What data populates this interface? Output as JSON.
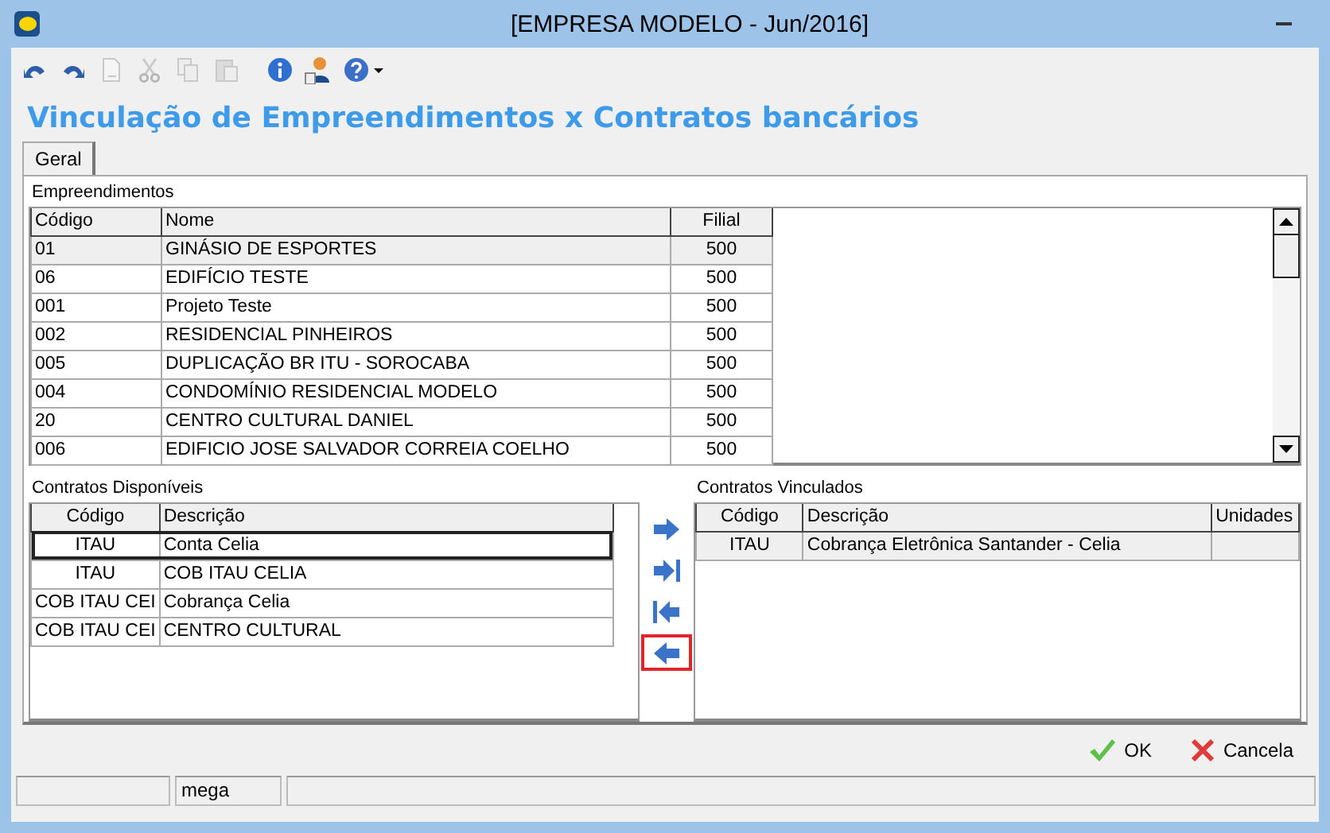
{
  "window": {
    "title": "[EMPRESA MODELO - Jun/2016]"
  },
  "toolbar": [
    {
      "kind": "undo",
      "disabled": false
    },
    {
      "kind": "redo",
      "disabled": false
    },
    {
      "kind": "document",
      "disabled": true
    },
    {
      "kind": "cut",
      "disabled": true
    },
    {
      "kind": "copy",
      "disabled": true
    },
    {
      "kind": "paste",
      "disabled": true
    },
    {
      "kind": "info",
      "disabled": false
    },
    {
      "kind": "user",
      "disabled": false
    },
    {
      "kind": "help",
      "disabled": false
    }
  ],
  "heading": "Vinculação de Empreendimentos x Contratos bancários",
  "tabs": [
    {
      "label": "Geral",
      "selected": true
    }
  ],
  "empreendimentos": {
    "label": "Empreendimentos",
    "columns": [
      "Código",
      "Nome",
      "Filial"
    ],
    "rows": [
      {
        "cells": [
          "01",
          "GINÁSIO DE ESPORTES",
          "500"
        ],
        "selected": true
      },
      {
        "cells": [
          "06",
          "EDIFÍCIO TESTE",
          "500"
        ],
        "selected": false
      },
      {
        "cells": [
          "001",
          "Projeto Teste",
          "500"
        ],
        "selected": false
      },
      {
        "cells": [
          "002",
          "RESIDENCIAL PINHEIROS",
          "500"
        ],
        "selected": false
      },
      {
        "cells": [
          "005",
          "DUPLICAÇÃO BR ITU - SOROCABA",
          "500"
        ],
        "selected": false
      },
      {
        "cells": [
          "004",
          "CONDOMÍNIO RESIDENCIAL MODELO",
          "500"
        ],
        "selected": false
      },
      {
        "cells": [
          "20",
          "CENTRO CULTURAL DANIEL",
          "500"
        ],
        "selected": false
      },
      {
        "cells": [
          "006",
          "EDIFICIO JOSE SALVADOR CORREIA COELHO",
          "500"
        ],
        "selected": false
      }
    ]
  },
  "disponiveis": {
    "label": "Contratos Disponíveis",
    "columns": [
      "Código",
      "Descrição"
    ],
    "rows": [
      {
        "cells": [
          "ITAU",
          "Conta Celia"
        ],
        "selected": true
      },
      {
        "cells": [
          "ITAU",
          "COB ITAU CELIA"
        ],
        "selected": false
      },
      {
        "cells": [
          "COB ITAU CEI",
          "Cobrança Celia"
        ],
        "selected": false
      },
      {
        "cells": [
          "COB ITAU CEI",
          "CENTRO CULTURAL"
        ],
        "selected": false
      }
    ]
  },
  "transfer_buttons": [
    {
      "kind": "right",
      "highlighted": false
    },
    {
      "kind": "right_all",
      "highlighted": false
    },
    {
      "kind": "left_all",
      "highlighted": false
    },
    {
      "kind": "left",
      "highlighted": true
    }
  ],
  "vinculados": {
    "label": "Contratos Vinculados",
    "columns": [
      "Código",
      "Descrição",
      "Unidades"
    ],
    "rows": [
      {
        "cells": [
          "ITAU",
          "Cobrança Eletrônica Santander - Celia",
          ""
        ],
        "selected": true
      }
    ]
  },
  "buttons": [
    {
      "kind": "ok",
      "label": "OK"
    },
    {
      "kind": "cancel",
      "label": "Cancela"
    }
  ],
  "status_bar": {
    "user": "mega"
  }
}
